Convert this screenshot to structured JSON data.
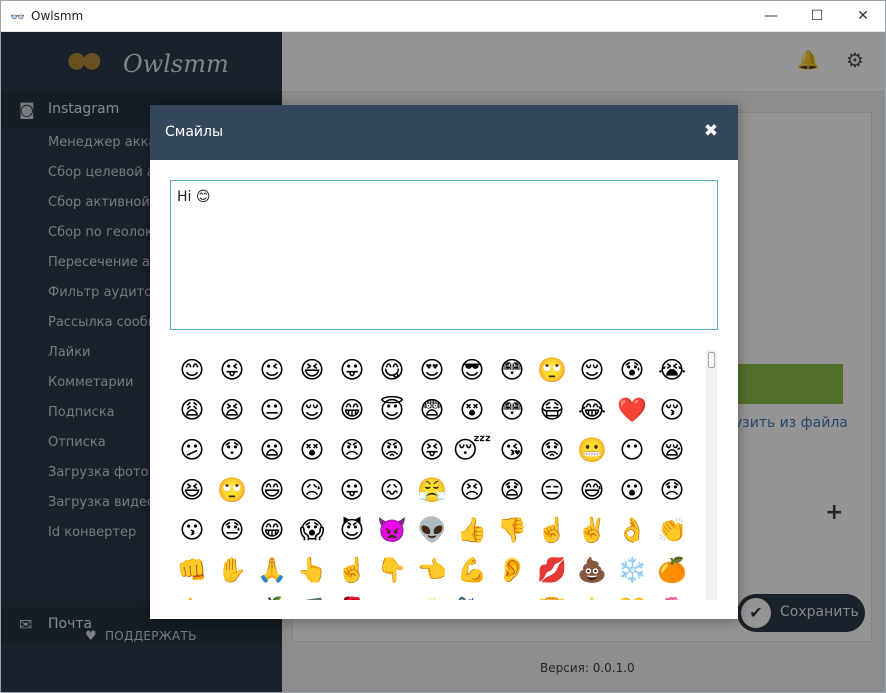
{
  "window": {
    "title": "Owlsmm",
    "minimize": "—",
    "maximize": "☐",
    "close": "✕"
  },
  "sidebar": {
    "logo": "Owlsmm",
    "instagram": "Instagram",
    "items": [
      "Менеджер аккау",
      "Сбор целевой ау",
      "Сбор активной а",
      "Сбор по геолока",
      "Пересечение ау",
      "Фильтр аудитор",
      "Рассылка сообщ",
      "Лайки",
      "Комметарии",
      "Подписка",
      "Отписка",
      "Загрузка фото",
      "Загрузка видео",
      "Id конвертер"
    ],
    "mail": "Почта",
    "support": "ПОДДЕРЖАТЬ"
  },
  "main": {
    "file_link": "узить из файла",
    "save": "Сохранить",
    "version": "Версия:  0.0.1.0"
  },
  "modal": {
    "title": "Смайлы",
    "close": "✖",
    "message": "Hi 😊",
    "emojis": [
      "😊",
      "😜",
      "😉",
      "😆",
      "😛",
      "😋",
      "😍",
      "😎",
      "😳",
      "🙄",
      "😌",
      "😰",
      "😭",
      "😩",
      "😫",
      "😐",
      "😌",
      "😁",
      "😇",
      "😨",
      "😵",
      "😳",
      "😷",
      "😂",
      "❤️",
      "😚",
      "😕",
      "😯",
      "😦",
      "😵",
      "😠",
      "😡",
      "😝",
      "😴",
      "😘",
      "😟",
      "😬",
      "😶",
      "😪",
      "😆",
      "🙄",
      "😄",
      "😥",
      "😛",
      "😖",
      "😤",
      "😣",
      "😧",
      "😑",
      "😅",
      "😮",
      "😞",
      "😗",
      "😓",
      "😁",
      "😱",
      "😈",
      "👿",
      "👽",
      "👍",
      "👎",
      "☝️",
      "✌️",
      "👌",
      "👏",
      "👊",
      "✋",
      "🙏",
      "👆",
      "☝️",
      "👇",
      "👈",
      "💪",
      "👂",
      "💋",
      "💩",
      "❄️",
      "🍊",
      "👉",
      "👐",
      "🍎",
      "🎵",
      "🌹",
      "👀",
      "🎂",
      "🌂",
      "☕",
      "🏆",
      "🌟",
      "💛",
      "🌷"
    ]
  },
  "colors": {
    "sidebar": "#2c3a4a",
    "modal_header": "#34475b",
    "textarea_border": "#5aa9d6",
    "accent_green": "#8cbf4a",
    "link": "#3c7dbf"
  }
}
